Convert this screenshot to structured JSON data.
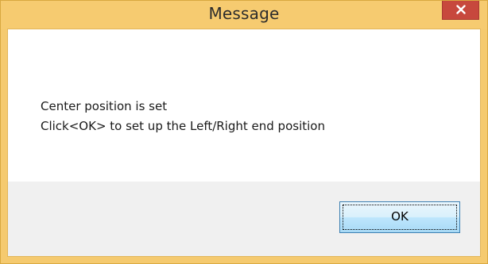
{
  "window": {
    "title": "Message",
    "close_icon": "close-icon",
    "titlebar_color": "#f6cb70",
    "close_button_color": "#c7483d"
  },
  "message": {
    "line1": "Center position is set",
    "line2": "Click<OK> to set up the Left/Right end position"
  },
  "buttons": {
    "ok_label": "OK"
  }
}
